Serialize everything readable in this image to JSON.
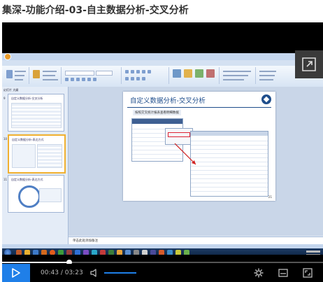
{
  "page": {
    "title": "集深-功能介绍-03-自主数据分析-交叉分析"
  },
  "ppt": {
    "tabs": [
      "开始",
      "插入",
      "设计",
      "动画",
      "幻灯片放映",
      "审阅",
      "视图"
    ],
    "left_tabs": "幻灯片 大纲",
    "slides": [
      {
        "num": "9",
        "title": "自定义数据分析-交叉分析"
      },
      {
        "num": "10",
        "title": "自定义数据分析-表达方式"
      },
      {
        "num": "11",
        "title": "自定义数据分析-表达方式"
      }
    ],
    "slide": {
      "title": "自定义数据分析-交叉分析",
      "subtitle": "按照交叉统计报表查看明细数据",
      "number": "21"
    },
    "notes": "单击此处添加备注"
  },
  "player": {
    "current_time": "00:43",
    "separator": "/",
    "duration": "03:23",
    "progress": 0.21,
    "volume": 0.35
  },
  "icons": [
    "expand-icon",
    "play-icon",
    "volume-icon",
    "settings-icon",
    "caption-icon",
    "fullscreen-icon"
  ]
}
